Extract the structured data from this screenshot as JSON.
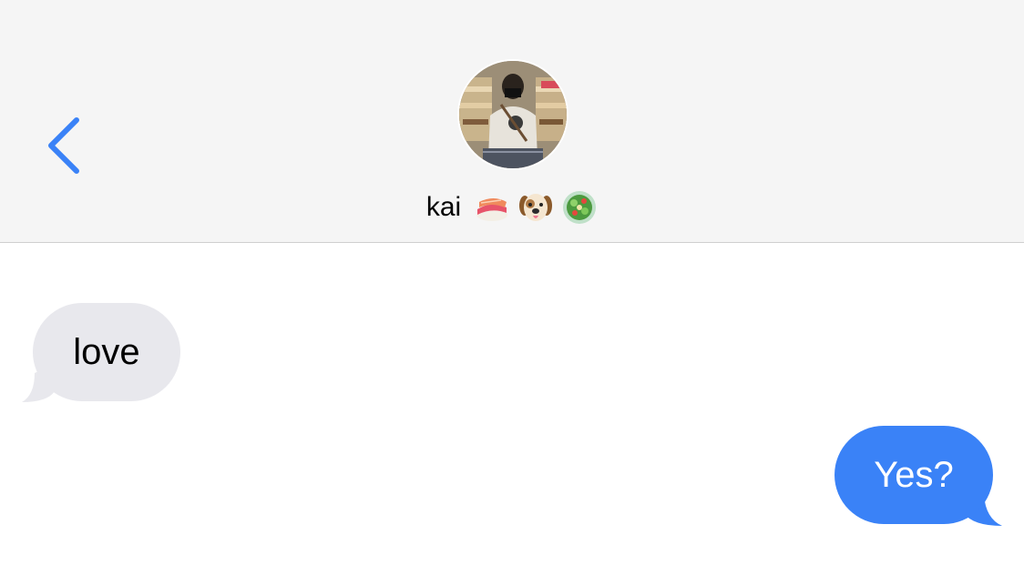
{
  "header": {
    "contact_name": "kai",
    "emojis": [
      "sushi-emoji",
      "dog-face-emoji",
      "salad-emoji"
    ],
    "back_icon": "chevron-left-icon",
    "accent_color": "#3a82f7"
  },
  "messages": [
    {
      "direction": "received",
      "text": "love",
      "bubble_color": "#e8e8ed"
    },
    {
      "direction": "sent",
      "text": "Yes?",
      "bubble_color": "#3a82f7"
    }
  ]
}
